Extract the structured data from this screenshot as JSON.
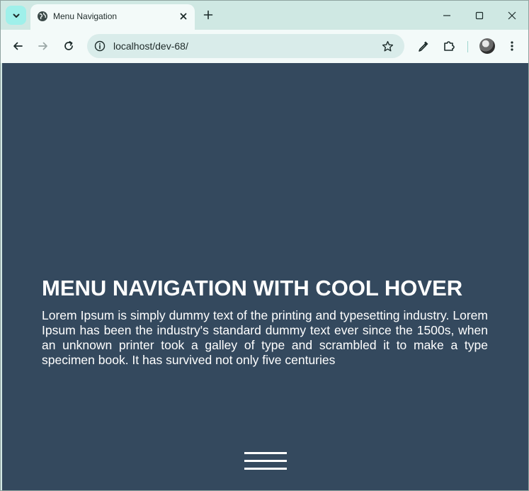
{
  "browser": {
    "tab": {
      "title": "Menu Navigation",
      "favicon_icon": "globe-icon",
      "close_icon": "close-icon"
    },
    "new_tab_icon": "plus-icon",
    "tab_search_icon": "chevron-down-icon",
    "window_controls": [
      "minimize-icon",
      "maximize-icon",
      "close-icon"
    ],
    "toolbar": {
      "back_icon": "back-arrow-icon",
      "forward_icon": "forward-arrow-icon",
      "reload_icon": "reload-icon",
      "site_info_icon": "info-icon",
      "url": "localhost/dev-68/",
      "bookmark_icon": "star-icon",
      "extensions": [
        "eyedropper-icon",
        "puzzle-icon"
      ],
      "menu_icon": "kebab-menu-icon"
    }
  },
  "page": {
    "background": "#34495e",
    "heading": "MENU NAVIGATION WITH COOL HOVER",
    "paragraph": "Lorem Ipsum is simply dummy text of the printing and typesetting industry. Lorem Ipsum has been the industry's standard dummy text ever since the 1500s, when an unknown printer took a galley of type and scrambled it to make a type specimen book. It has survived not only five centuries",
    "menu_toggle_icon": "hamburger-icon"
  }
}
